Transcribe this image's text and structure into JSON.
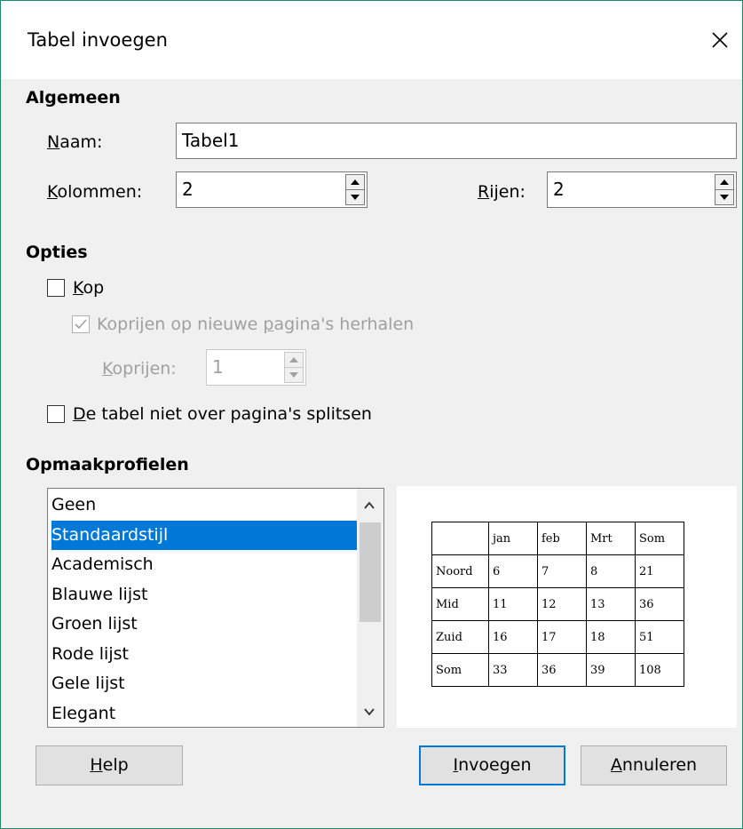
{
  "window": {
    "title": "Tabel invoegen"
  },
  "algemeen": {
    "heading": "Algemeen",
    "naam_label": "Naam:",
    "naam_value": "Tabel1",
    "kolommen_label": "Kolommen:",
    "kolommen_value": "2",
    "rijen_label": "Rijen:",
    "rijen_value": "2"
  },
  "opties": {
    "heading": "Opties",
    "kop_label": "Kop",
    "kop_checked": false,
    "koprijen_herhalen_label": "Koprijen op nieuwe pagina's herhalen",
    "koprijen_herhalen_checked": true,
    "koprijen_label": "Koprijen:",
    "koprijen_value": "1",
    "niet_splitsen_label": "De tabel niet over pagina's splitsen",
    "niet_splitsen_checked": false
  },
  "opmaakprofielen": {
    "heading": "Opmaakprofielen",
    "items": [
      "Geen",
      "Standaardstijl",
      "Academisch",
      "Blauwe lijst",
      "Groen lijst",
      "Rode lijst",
      "Gele lijst",
      "Elegant"
    ],
    "selected": "Standaardstijl"
  },
  "preview": {
    "rows": [
      [
        "",
        "jan",
        "feb",
        "Mrt",
        "Som"
      ],
      [
        "Noord",
        "6",
        "7",
        "8",
        "21"
      ],
      [
        "Mid",
        "11",
        "12",
        "13",
        "36"
      ],
      [
        "Zuid",
        "16",
        "17",
        "18",
        "51"
      ],
      [
        "Som",
        "33",
        "36",
        "39",
        "108"
      ]
    ]
  },
  "buttons": {
    "help": "Help",
    "invoegen": "Invoegen",
    "annuleren": "Annuleren"
  },
  "colors": {
    "selection": "#0078d7",
    "window_border": "#1f8a6b",
    "default_button_border": "#0078d7"
  }
}
